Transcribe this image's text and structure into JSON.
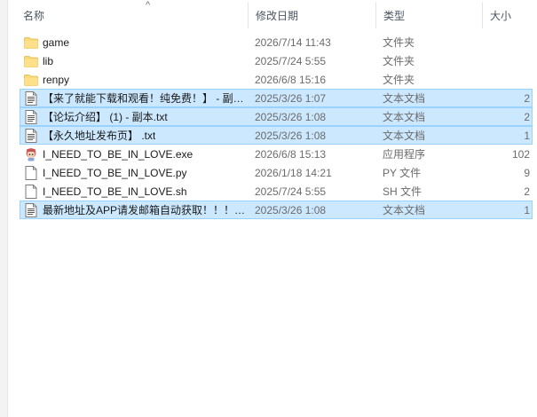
{
  "columns": {
    "name": "名称",
    "date": "修改日期",
    "type": "类型",
    "size": "大小"
  },
  "sort_indicator": "^",
  "rows": [
    {
      "name": "game",
      "date": "2026/7/14 11:43",
      "type": "文件夹",
      "size": "",
      "icon": "folder-icon",
      "selected": false
    },
    {
      "name": "lib",
      "date": "2025/7/24 5:55",
      "type": "文件夹",
      "size": "",
      "icon": "folder-icon",
      "selected": false
    },
    {
      "name": "renpy",
      "date": "2026/6/8 15:16",
      "type": "文件夹",
      "size": "",
      "icon": "folder-icon",
      "selected": false
    },
    {
      "name": "【来了就能下载和观看！纯免费！】 - 副…",
      "date": "2025/3/26 1:07",
      "type": "文本文档",
      "size": "2",
      "icon": "text-document-icon",
      "selected": true
    },
    {
      "name": "【论坛介绍】 (1) - 副本.txt",
      "date": "2025/3/26 1:08",
      "type": "文本文档",
      "size": "2",
      "icon": "text-document-icon",
      "selected": true
    },
    {
      "name": "【永久地址发布页】 .txt",
      "date": "2025/3/26 1:08",
      "type": "文本文档",
      "size": "1",
      "icon": "text-document-icon",
      "selected": true
    },
    {
      "name": "I_NEED_TO_BE_IN_LOVE.exe",
      "date": "2026/6/8 15:13",
      "type": "应用程序",
      "size": "102",
      "icon": "app-executable-icon",
      "selected": false
    },
    {
      "name": "I_NEED_TO_BE_IN_LOVE.py",
      "date": "2026/1/18 14:21",
      "type": "PY 文件",
      "size": "9",
      "icon": "blank-file-icon",
      "selected": false
    },
    {
      "name": "I_NEED_TO_BE_IN_LOVE.sh",
      "date": "2025/7/24 5:55",
      "type": "SH 文件",
      "size": "2",
      "icon": "blank-file-icon",
      "selected": false
    },
    {
      "name": "最新地址及APP请发邮箱自动获取！！！…",
      "date": "2025/3/26 1:08",
      "type": "文本文档",
      "size": "1",
      "icon": "text-document-icon",
      "selected": true
    }
  ],
  "colors": {
    "selected_bg": "#cce8ff",
    "selected_border": "#99d1ff",
    "folder": "#f8d775"
  }
}
